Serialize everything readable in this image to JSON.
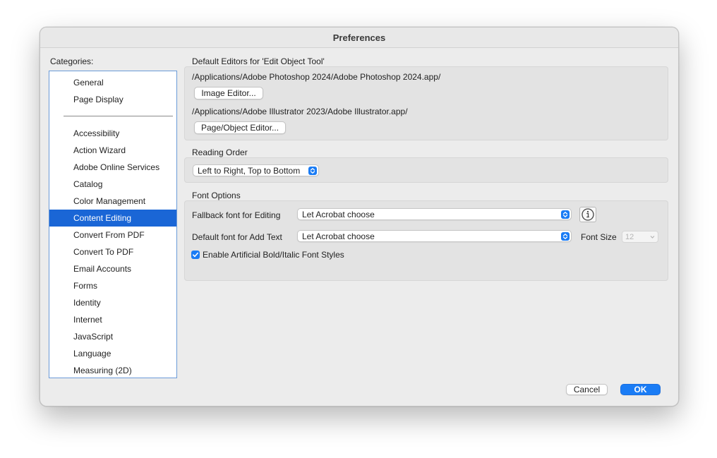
{
  "window": {
    "title": "Preferences"
  },
  "sidebar": {
    "label": "Categories:",
    "top_items": [
      {
        "label": "General"
      },
      {
        "label": "Page Display"
      }
    ],
    "items": [
      {
        "label": "Accessibility"
      },
      {
        "label": "Action Wizard"
      },
      {
        "label": "Adobe Online Services"
      },
      {
        "label": "Catalog"
      },
      {
        "label": "Color Management"
      },
      {
        "label": "Content Editing",
        "selected": true
      },
      {
        "label": "Convert From PDF"
      },
      {
        "label": "Convert To PDF"
      },
      {
        "label": "Email Accounts"
      },
      {
        "label": "Forms"
      },
      {
        "label": "Identity"
      },
      {
        "label": "Internet"
      },
      {
        "label": "JavaScript"
      },
      {
        "label": "Language"
      },
      {
        "label": "Measuring (2D)"
      }
    ]
  },
  "default_editors": {
    "heading": "Default Editors for 'Edit Object Tool'",
    "image_editor_path": "/Applications/Adobe Photoshop 2024/Adobe Photoshop 2024.app/",
    "image_editor_button": "Image Editor...",
    "page_object_editor_path": "/Applications/Adobe Illustrator 2023/Adobe Illustrator.app/",
    "page_object_editor_button": "Page/Object Editor..."
  },
  "reading_order": {
    "heading": "Reading Order",
    "value": "Left to Right, Top to Bottom"
  },
  "font_options": {
    "heading": "Font Options",
    "fallback_label": "Fallback font for Editing",
    "fallback_value": "Let Acrobat choose",
    "default_label": "Default font for Add Text",
    "default_value": "Let Acrobat choose",
    "font_size_label": "Font Size",
    "font_size_value": "12",
    "artificial_styles_label": "Enable Artificial Bold/Italic Font Styles",
    "artificial_styles_checked": true
  },
  "footer": {
    "cancel_label": "Cancel",
    "ok_label": "OK"
  },
  "colors": {
    "accent": "#1a7cf5",
    "selection": "#1a66d6"
  }
}
